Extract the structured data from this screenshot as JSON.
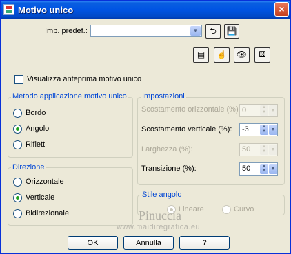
{
  "window": {
    "title": "Motivo unico",
    "close_label": "×"
  },
  "preset": {
    "label": "Imp. predef.:",
    "value": ""
  },
  "preview_checkbox": {
    "label": "Visualizza anteprima motivo unico",
    "checked": false
  },
  "method_group": {
    "title": "Metodo applicazione motivo unico",
    "options": [
      {
        "label": "Bordo",
        "selected": false
      },
      {
        "label": "Angolo",
        "selected": true
      },
      {
        "label": "Riflett",
        "selected": false
      }
    ]
  },
  "direction_group": {
    "title": "Direzione",
    "options": [
      {
        "label": "Orizzontale",
        "selected": false
      },
      {
        "label": "Verticale",
        "selected": true
      },
      {
        "label": "Bidirezionale",
        "selected": false
      }
    ]
  },
  "settings_group": {
    "title": "Impostazioni",
    "fields": [
      {
        "label": "Scostamento orizzontale (%):",
        "value": "0",
        "enabled": false
      },
      {
        "label": "Scostamento verticale (%):",
        "value": "-3",
        "enabled": true
      },
      {
        "label": "Larghezza (%):",
        "value": "50",
        "enabled": false
      },
      {
        "label": "Transizione (%):",
        "value": "50",
        "enabled": true
      }
    ]
  },
  "corner_style_group": {
    "title": "Stile angolo",
    "options": [
      {
        "label": "Lineare",
        "selected": true,
        "enabled": false
      },
      {
        "label": "Curvo",
        "selected": false,
        "enabled": false
      }
    ]
  },
  "watermark": {
    "line1": "Pinuccia",
    "line2": "www.maidiregrafica.eu"
  },
  "buttons": {
    "ok": "OK",
    "cancel": "Annulla",
    "help": "?"
  }
}
